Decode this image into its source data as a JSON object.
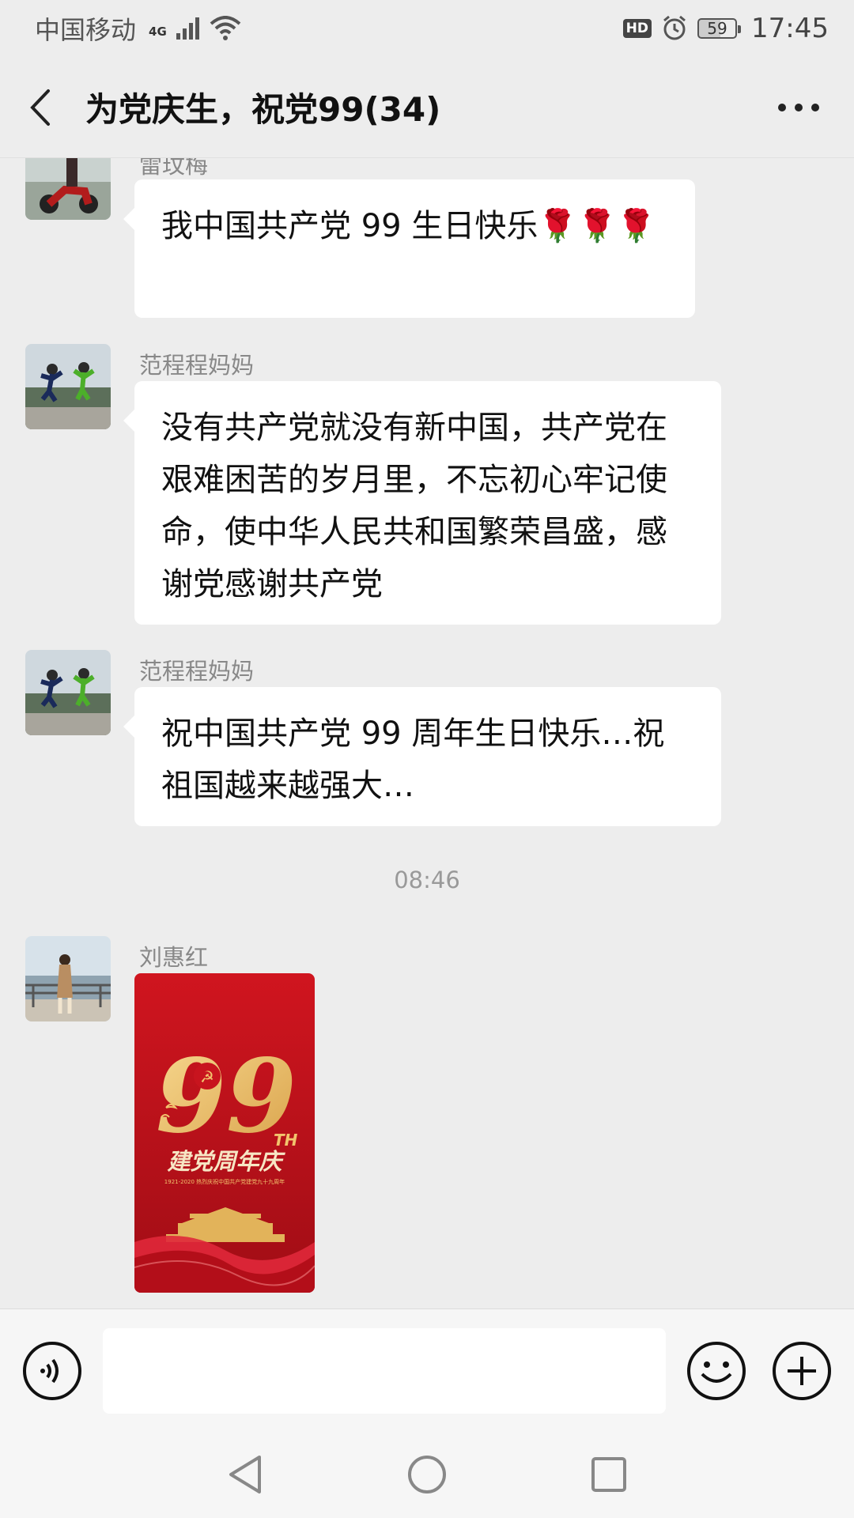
{
  "status_bar": {
    "carrier": "中国移动",
    "network": "4G",
    "hd": "HD",
    "battery": "59",
    "time": "17:45"
  },
  "title_bar": {
    "title": "为党庆生，祝党99(34)"
  },
  "messages": [
    {
      "sender": "雷玟梅",
      "text": "我中国共产党 99 生日快乐🌹🌹🌹"
    },
    {
      "sender": "范程程妈妈",
      "text": "没有共产党就没有新中国，共产党在艰难困苦的岁月里，不忘初心牢记使命，使中华人民共和国繁荣昌盛，感谢党感谢共产党"
    },
    {
      "sender": "范程程妈妈",
      "text": "祝中国共产党 99 周年生日快乐…祝祖国越来越强大…"
    },
    {
      "sender": "刘惠红",
      "image": {
        "big_number": "99",
        "suffix": "TH",
        "headline": "建党周年庆",
        "subline": "1921-2020 热烈庆祝中国共产党建党九十九周年"
      }
    }
  ],
  "timestamp": "08:46",
  "colors": {
    "background": "#ededed",
    "bubble": "#ffffff",
    "poster_red": "#c8141e",
    "poster_gold": "#f2c46d"
  }
}
